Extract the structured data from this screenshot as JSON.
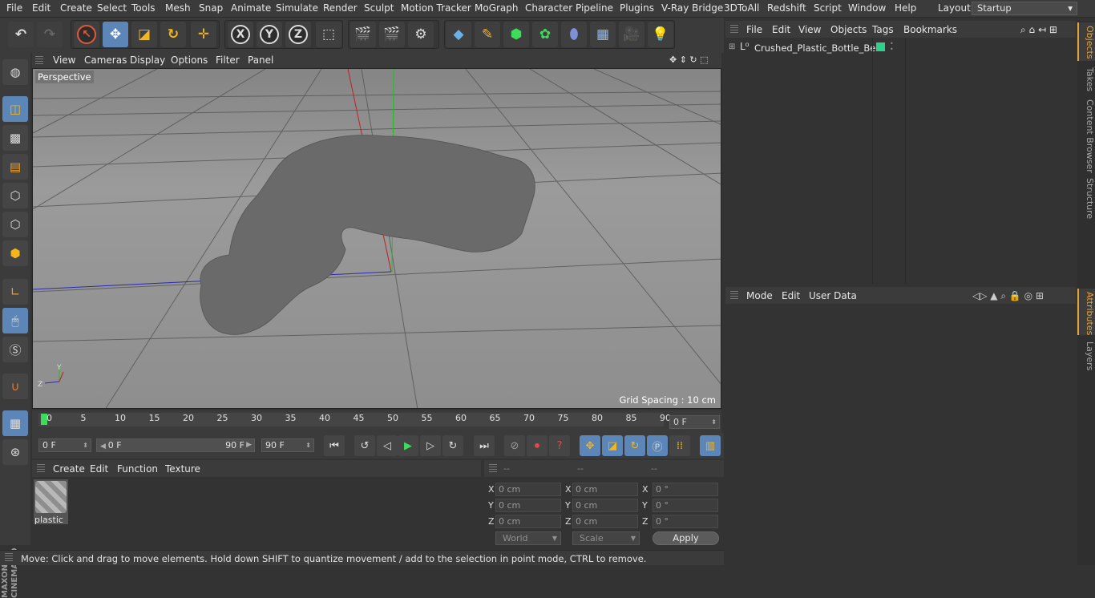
{
  "menubar": {
    "items": [
      "File",
      "Edit",
      "Create",
      "Select",
      "Tools",
      "Mesh",
      "Snap",
      "Animate",
      "Simulate",
      "Render",
      "Sculpt",
      "Motion Tracker",
      "MoGraph",
      "Character",
      "Pipeline",
      "Plugins",
      "V-Ray Bridge",
      "3DToAll",
      "Redshift",
      "Script",
      "Window",
      "Help"
    ],
    "layout_label": "Layout:",
    "layout_value": "Startup"
  },
  "toolbar": {
    "axis_x": "X",
    "axis_y": "Y",
    "axis_z": "Z"
  },
  "viewport": {
    "menu": [
      "View",
      "Cameras",
      "Display",
      "Options",
      "Filter",
      "Panel"
    ],
    "label": "Perspective",
    "grid_spacing": "Grid Spacing : 10 cm",
    "axis_y_label": "Y",
    "axis_z_label": "Z"
  },
  "timeline": {
    "ticks": [
      "0",
      "5",
      "10",
      "15",
      "20",
      "25",
      "30",
      "35",
      "40",
      "45",
      "50",
      "55",
      "60",
      "65",
      "70",
      "75",
      "80",
      "85",
      "90"
    ],
    "current_frame": "0 F",
    "start_field": "0 F",
    "range_start": "0 F",
    "range_end": "90 F",
    "end_field": "90 F"
  },
  "material_manager": {
    "menu": [
      "Create",
      "Edit",
      "Function",
      "Texture"
    ],
    "materials": [
      {
        "name": "plastic"
      }
    ]
  },
  "coordinates": {
    "headers": [
      "--",
      "--",
      "--"
    ],
    "rows": [
      {
        "axis": "X",
        "pos": "0 cm",
        "size": "0 cm",
        "rot_axis": "X",
        "rot": "0 °"
      },
      {
        "axis": "Y",
        "pos": "0 cm",
        "size": "0 cm",
        "rot_axis": "Y",
        "rot": "0 °"
      },
      {
        "axis": "Z",
        "pos": "0 cm",
        "size": "0 cm",
        "rot_axis": "Z",
        "rot": "0 °"
      }
    ],
    "space_dropdown": "World",
    "mode_dropdown": "Scale",
    "apply_label": "Apply"
  },
  "status": {
    "text": "Move: Click and drag to move elements. Hold down SHIFT to quantize movement / add to the selection in point mode, CTRL to remove."
  },
  "object_manager": {
    "menu": [
      "File",
      "Edit",
      "View",
      "Objects",
      "Tags",
      "Bookmarks"
    ],
    "objects": [
      {
        "name": "Crushed_Plastic_Bottle_Bent",
        "tag_color": "#2fd08c"
      }
    ]
  },
  "attribute_manager": {
    "menu": [
      "Mode",
      "Edit",
      "User Data"
    ]
  },
  "right_tabs": {
    "top": [
      "Objects",
      "Takes",
      "Content Browser",
      "Structure"
    ],
    "bottom": [
      "Attributes",
      "Layers"
    ]
  },
  "branding": "MAXON CINEMA 4D",
  "colors": {
    "accent_blue": "#5d86b8",
    "highlight_orange": "#e6a43a",
    "tag_green": "#2fd08c",
    "play_green": "#3ddc5a"
  }
}
